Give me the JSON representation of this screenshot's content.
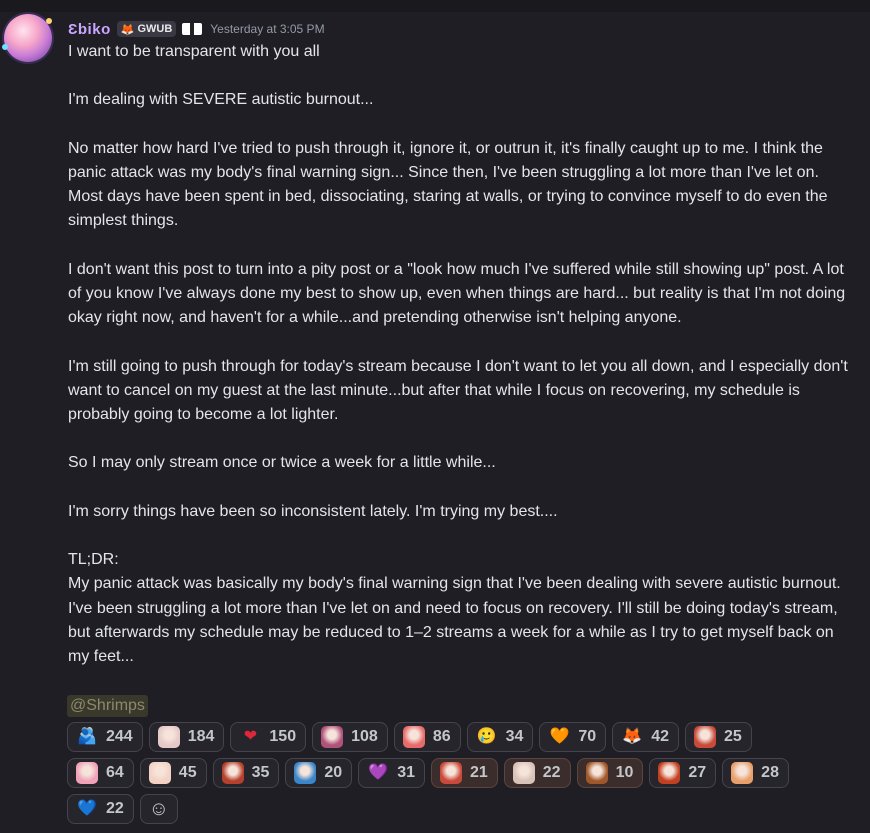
{
  "author": {
    "username": "Ɛbiko",
    "tag_text": "GWUB",
    "tag_icon": "🦊",
    "timestamp": "Yesterday at 3:05 PM"
  },
  "message": {
    "paragraphs": [
      "I want to be transparent with you all",
      "I'm dealing with SEVERE autistic burnout...",
      "No matter how hard I've tried to push through it, ignore it, or outrun it, it's finally caught up to me. I think the panic attack was my body's final warning sign... Since then, I've been struggling a lot more than I've let on. Most days have been spent in bed, dissociating, staring at walls, or trying to convince myself to do even the simplest things.",
      "I don't want this post to turn into a pity post or a \"look how much I've suffered while still showing up\" post. A lot of you know I've always done my best to show up, even when things are hard... but reality is that I'm not doing okay right now, and haven't for a while...and pretending otherwise isn't helping anyone.",
      "I'm still going to push through for today's stream because I don't want to let you all down, and I especially don't want to cancel on my guest at the last minute...but after that while I focus on recovering, my schedule is probably going to become a lot lighter.",
      "So I may only stream once or twice a week for a little while...",
      "I'm sorry things have been so inconsistent lately. I'm trying my best....",
      "TL;DR:",
      "My panic attack was basically my body's final warning sign that I've been dealing with severe autistic burnout. I've been struggling a lot more than I've let on and need to focus on recovery. I'll still be doing today's stream, but afterwards my schedule may be reduced to 1–2 streams a week for a while as I try to get myself back on my feet..."
    ],
    "mention": "@Shrimps"
  },
  "reactions": {
    "row1": [
      {
        "icon": "hug-emoji-icon",
        "glyph": "🫂",
        "color": "#4a7fd6",
        "count": "244"
      },
      {
        "icon": "anime-girl-emoji-icon",
        "glyph": "",
        "color": "#e6c9c9",
        "count": "184"
      },
      {
        "icon": "red-heart-icon",
        "glyph": "❤",
        "color": "#e1263c",
        "count": "150"
      },
      {
        "icon": "heart-hug-emoji-icon",
        "glyph": "",
        "color": "#b0527a",
        "count": "108"
      },
      {
        "icon": "cat-face-emoji-icon",
        "glyph": "",
        "color": "#e86b6b",
        "count": "86"
      },
      {
        "icon": "holding-back-tears-icon",
        "glyph": "🥲",
        "color": "#f5c542",
        "count": "34"
      },
      {
        "icon": "orange-heart-icon",
        "glyph": "🧡",
        "color": "#f28c1a",
        "count": "70"
      },
      {
        "icon": "fox-emoji-icon",
        "glyph": "🦊",
        "color": "#e0672a",
        "count": "42"
      },
      {
        "icon": "crying-character-emoji-icon",
        "glyph": "",
        "color": "#c84b3a",
        "count": "25"
      }
    ],
    "row2": [
      {
        "icon": "pink-character-emoji-icon",
        "glyph": "",
        "color": "#f0a3b8",
        "count": "64"
      },
      {
        "icon": "crying-face-emoji-icon",
        "glyph": "",
        "color": "#f3d2c4",
        "count": "45"
      },
      {
        "icon": "cup-emoji-icon",
        "glyph": "",
        "color": "#b5402c",
        "count": "35"
      },
      {
        "icon": "sunrise-card-emoji-icon",
        "glyph": "",
        "color": "#3a86c9",
        "count": "20"
      },
      {
        "icon": "purple-heart-icon",
        "glyph": "💜",
        "color": "#9c6bd6",
        "count": "31"
      },
      {
        "icon": "dots-emoji-icon",
        "glyph": "",
        "color": "#c94a3a",
        "count": "21",
        "highlight": true
      },
      {
        "icon": "character-sticker-emoji-icon",
        "glyph": "",
        "color": "#d9c2b8",
        "count": "22",
        "highlight": true
      },
      {
        "icon": "brown-character-emoji-icon",
        "glyph": "",
        "color": "#a0582a",
        "count": "10",
        "highlight": true
      },
      {
        "icon": "angel-fox-emoji-icon",
        "glyph": "",
        "color": "#c2401f",
        "count": "27"
      },
      {
        "icon": "cat-sad-emoji-icon",
        "glyph": "",
        "color": "#e8a06a",
        "count": "28"
      }
    ],
    "row3": [
      {
        "icon": "blue-heart-icon",
        "glyph": "💙",
        "color": "#4aa3e8",
        "count": "22"
      }
    ],
    "add_reaction_icon": "add-reaction-icon"
  }
}
